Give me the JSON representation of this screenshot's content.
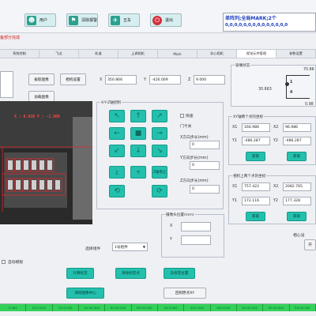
{
  "toolbar": {
    "buttons": [
      {
        "label": "用户",
        "icon": "user-icon"
      },
      {
        "label": "清除报警",
        "icon": "alarm-clear-icon"
      },
      {
        "label": "五车",
        "icon": "truck-icon"
      },
      {
        "label": "退出",
        "icon": "power-icon"
      }
    ]
  },
  "status_panel": {
    "title": "单阵列;全局MARK;2个",
    "values": "0,0,0,0,0,0,0,0,0,0,0,0,0,0"
  },
  "warning_text": "备部分完成",
  "tabs": [
    "系统控制",
    "飞达",
    "轨道",
    "上调相机",
    "Mark",
    "非心相机",
    "视觉元件管理",
    "参数设置"
  ],
  "active_tab": 6,
  "left_side": {
    "btn_a": "拔取图像",
    "btn_b": "相机设置",
    "btn_c": "加载图像",
    "overlay": "X : 0.039 Y : -1.000",
    "auto_check": "自动模版"
  },
  "coords": {
    "x_label": "X",
    "x_value": "350.866",
    "y_label": "Y",
    "y_value": "-426.009",
    "z_label": "Z",
    "z_value": "9.000"
  },
  "xyz_move": {
    "title": "X-Y-Z轴控制",
    "xy_label": "X",
    "xy_value": "0",
    "step_label": "X方向步长(mm)",
    "y_step_label": "Y方向步长(mm)",
    "y_step_value": "0",
    "z_step_label": "Z方向步长(mm)",
    "z_step_value": "0",
    "fast_check": "快速",
    "door_check": "门卡关",
    "up": "上",
    "down": "下",
    "z_label": "Z轴停止"
  },
  "cam_pos": {
    "title": "摄像头位置(mm)",
    "x_label": "X",
    "y_label": "Y"
  },
  "params": {
    "select_label": "选择组件",
    "select_value": "1号组件"
  },
  "right_panel": {
    "title": "吸嘴状态",
    "val_top": "70.86",
    "val_left": "30.663",
    "val_bottom": "0.98",
    "p1": "1",
    "p2": "4"
  },
  "xy_set1": {
    "title": "XY轴两个点的坐标",
    "x1_label": "X1",
    "x1": "166.986",
    "x2_label": "X2",
    "x2": "96.986",
    "y1_label": "Y1",
    "y1": "-486.287",
    "y2_label": "Y2",
    "y2": "-486.287",
    "btn1": "获取",
    "btn2": "获取"
  },
  "xy_set2": {
    "title": "相机上两个点的坐标",
    "x1_label": "X1",
    "x1": "757.422",
    "x2_label": "X2",
    "x2": "2082.765",
    "y1_label": "Y1",
    "y1": "172.116",
    "y2_label": "Y2",
    "y2": "177.328",
    "btn1": "获取",
    "btn2": "获取"
  },
  "right_bottom": {
    "label": "相心设",
    "btn": "开"
  },
  "bottom_buttons": {
    "b1": "计算标定",
    "b2": "清除标定点",
    "b3": "去标定位置",
    "b4": "清除图像中心",
    "b5": "回到原点XY"
  },
  "status_bar": [
    "0.063",
    "Z2:0.000",
    "Z3:0.000",
    "R1:90.000",
    "R2:90.000",
    "R3:90.000",
    "Z4:0.000",
    "Z5:0.000",
    "Z6:0.000",
    "R4:90.000",
    "R5:90.000",
    "R6:90.000"
  ],
  "colors": {
    "teal": "#23c0ad",
    "status_green": "#34d15a",
    "warn_red": "#d21e1e"
  }
}
